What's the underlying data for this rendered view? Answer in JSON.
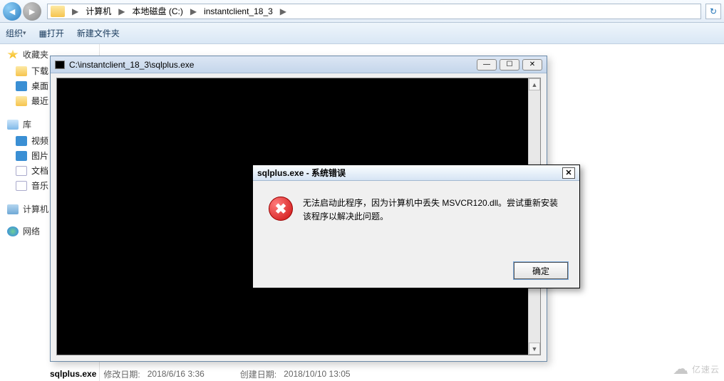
{
  "addressbar": {
    "items": [
      "计算机",
      "本地磁盘 (C:)",
      "instantclient_18_3"
    ],
    "sep": "▶",
    "refresh_icon": "↻"
  },
  "toolbar": {
    "organize": "组织",
    "open": "打开",
    "newfolder": "新建文件夹"
  },
  "sidebar": {
    "fav": {
      "head": "收藏夹",
      "items": [
        "下载",
        "桌面",
        "最近"
      ]
    },
    "lib": {
      "head": "库",
      "items": [
        "视频",
        "图片",
        "文档",
        "音乐"
      ]
    },
    "computer": "计算机",
    "network": "网络"
  },
  "console": {
    "title": "C:\\instantclient_18_3\\sqlplus.exe",
    "min": "—",
    "max": "☐",
    "close": "✕"
  },
  "dialog": {
    "title": "sqlplus.exe - 系统错误",
    "message": "无法启动此程序，因为计算机中丢失 MSVCR120.dll。尝试重新安装该程序以解决此问题。",
    "ok": "确定",
    "close": "✕"
  },
  "bottom": {
    "filename": "sqlplus.exe",
    "mod_label": "修改日期:",
    "mod_value": "2018/6/16 3:36",
    "create_label": "创建日期:",
    "create_value": "2018/10/10 13:05"
  },
  "watermark": "亿速云"
}
